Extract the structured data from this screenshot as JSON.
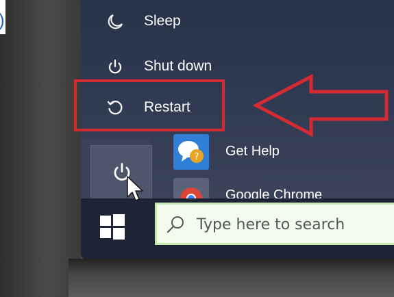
{
  "power_menu": {
    "items": [
      {
        "label": "Sleep",
        "icon": "moon-icon"
      },
      {
        "label": "Shut down",
        "icon": "power-icon"
      },
      {
        "label": "Restart",
        "icon": "restart-icon"
      }
    ]
  },
  "apps": [
    {
      "label": "Get Help",
      "icon": "get-help-icon"
    },
    {
      "label": "Google Chrome",
      "icon": "chrome-icon"
    }
  ],
  "taskbar": {
    "search_placeholder": "Type here to search"
  },
  "annotation": {
    "paren": ")",
    "highlight_color": "#d62a32"
  },
  "colors": {
    "menu_bg": "#2e3850",
    "taskbar_bg": "#1d2436",
    "search_bg": "#f4fbee",
    "accent": "#d62a32"
  }
}
